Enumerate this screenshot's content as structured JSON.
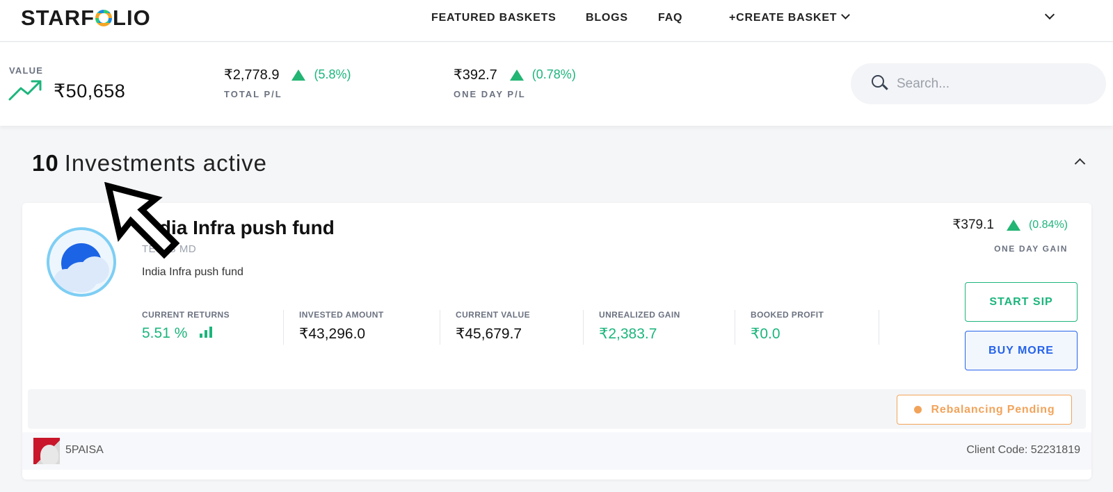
{
  "header": {
    "logo_text": "STARFOLIO",
    "nav": {
      "featured": "FEATURED BASKETS",
      "blogs": "BLOGS",
      "faq": "FAQ",
      "create": "+CREATE BASKET"
    }
  },
  "summary": {
    "value_label": "VALUE",
    "value": "₹50,658",
    "total_pl": {
      "amount": "₹2,778.9",
      "percent": "(5.8%)",
      "label": "TOTAL P/L"
    },
    "one_day_pl": {
      "amount": "₹392.7",
      "percent": "(0.78%)",
      "label": "ONE DAY P/L"
    },
    "search_placeholder": "Search..."
  },
  "investments": {
    "count": "10",
    "label": "Investments active"
  },
  "card": {
    "name": "India Infra push fund",
    "author": "TEJAS MD",
    "description": "India Infra push fund",
    "one_day_gain": {
      "amount": "₹379.1",
      "percent": "(0.84%)",
      "label": "ONE DAY GAIN"
    },
    "metrics": [
      {
        "label": "CURRENT RETURNS",
        "value": "5.51 %"
      },
      {
        "label": "INVESTED AMOUNT",
        "value": "₹43,296.0"
      },
      {
        "label": "CURRENT VALUE",
        "value": "₹45,679.7"
      },
      {
        "label": "UNREALIZED GAIN",
        "value": "₹2,383.7"
      },
      {
        "label": "BOOKED PROFIT",
        "value": "₹0.0"
      }
    ],
    "buttons": {
      "start_sip": "START SIP",
      "buy_more": "BUY MORE"
    },
    "rebalancing_status": "Rebalancing Pending",
    "broker": {
      "name": "5PAISA",
      "client_code": "Client Code: 52231819"
    }
  },
  "colors": {
    "positive": "#1cb57c",
    "accent_blue": "#2563eb",
    "warning": "#f2a35a"
  }
}
